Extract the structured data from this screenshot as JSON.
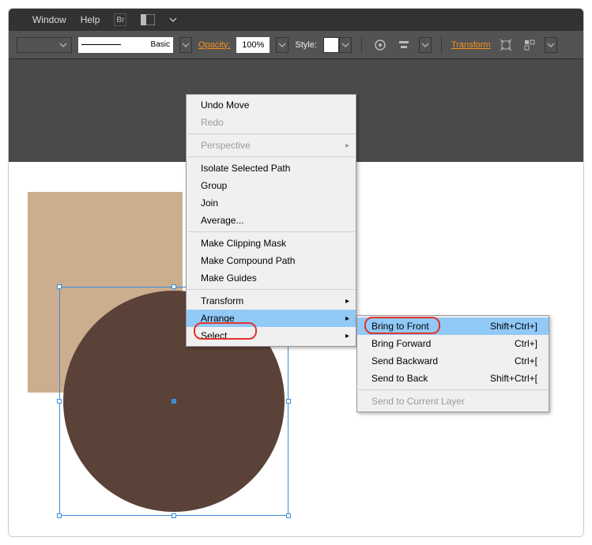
{
  "menubar": {
    "window": "Window",
    "help": "Help"
  },
  "optbar": {
    "stroke_style": "Basic",
    "opacity_label": "Opacity:",
    "opacity_value": "100%",
    "style_label": "Style:",
    "transform_label": "Transform"
  },
  "context_menu": {
    "undo": "Undo Move",
    "redo": "Redo",
    "perspective": "Perspective",
    "isolate": "Isolate Selected Path",
    "group": "Group",
    "join": "Join",
    "average": "Average...",
    "clip": "Make Clipping Mask",
    "compound": "Make Compound Path",
    "guides": "Make Guides",
    "transform": "Transform",
    "arrange": "Arrange",
    "select": "Select"
  },
  "submenu": {
    "bring_front": {
      "label": "Bring to Front",
      "shortcut": "Shift+Ctrl+]"
    },
    "bring_forward": {
      "label": "Bring Forward",
      "shortcut": "Ctrl+]"
    },
    "send_backward": {
      "label": "Send Backward",
      "shortcut": "Ctrl+["
    },
    "send_back": {
      "label": "Send to Back",
      "shortcut": "Shift+Ctrl+["
    },
    "send_layer": "Send to Current Layer"
  },
  "colors": {
    "tan": "#cbae8d",
    "circle": "#5a4238",
    "selection": "#3a8edb",
    "highlight_ring": "#e2342c",
    "menu_hl": "#91c9f7"
  }
}
